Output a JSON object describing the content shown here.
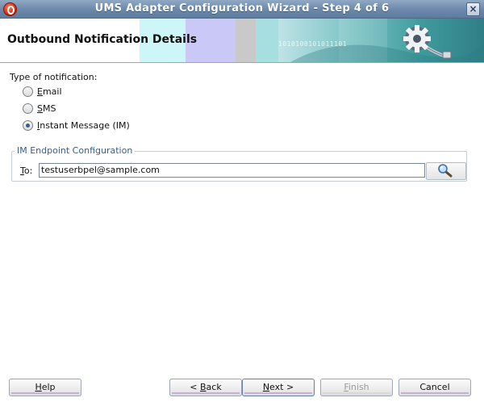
{
  "window": {
    "title": "UMS Adapter Configuration Wizard - Step 4 of 6",
    "close_glyph": "×",
    "icons": {
      "app": "oracle-app-icon",
      "close": "close-icon"
    }
  },
  "header": {
    "title": "Outbound Notification Details",
    "banner_digits": "1010100101011101",
    "icon": "gear-cable-icon"
  },
  "notification": {
    "label": "Type of notification:",
    "options": [
      {
        "mnemonic": "E",
        "rest": "mail",
        "selected": false
      },
      {
        "mnemonic": "S",
        "rest": "MS",
        "selected": false
      },
      {
        "mnemonic": "I",
        "rest": "nstant Message (IM)",
        "selected": true
      }
    ]
  },
  "endpoint": {
    "legend": "IM Endpoint Configuration",
    "to_mnemonic": "T",
    "to_rest": "o:",
    "to_value": "testuserbpel@sample.com",
    "lookup_icon": "magnifier-icon"
  },
  "buttons": {
    "help": {
      "mnemonic": "H",
      "rest": "elp"
    },
    "back": {
      "pre": "< ",
      "mnemonic": "B",
      "rest": "ack"
    },
    "next": {
      "mnemonic": "N",
      "rest": "ext >"
    },
    "finish": {
      "mnemonic": "F",
      "rest": "inish"
    },
    "cancel": {
      "label": "Cancel"
    }
  },
  "colors": {
    "title_bar": "#6b88aa",
    "accent": "#3c5c86",
    "banner_cyan": "#ccf5f7",
    "banner_lavender": "#c9c8f7",
    "banner_teal": "#4da3a6"
  }
}
